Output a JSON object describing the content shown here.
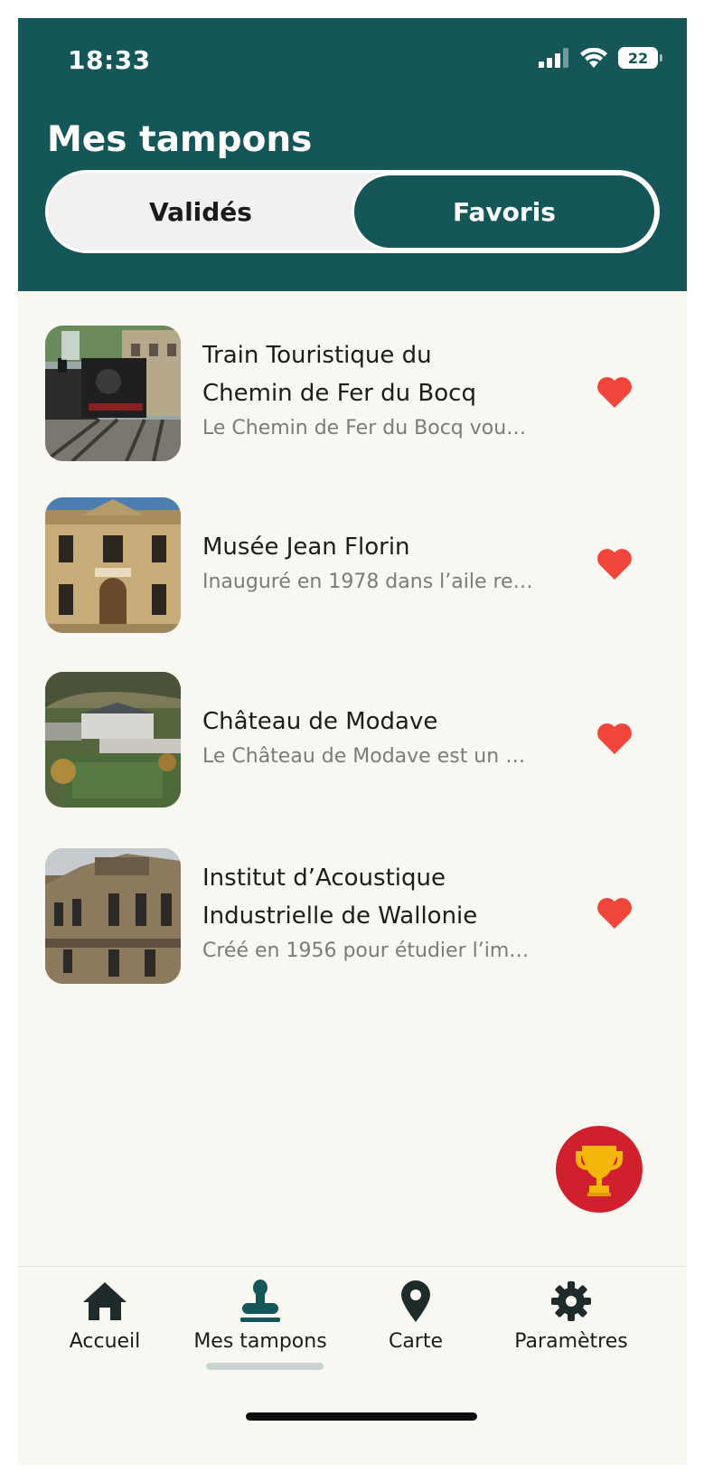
{
  "status_bar": {
    "time": "18:33",
    "battery": "22"
  },
  "header": {
    "title": "Mes tampons",
    "tabs": [
      {
        "label": "Validés",
        "active": false
      },
      {
        "label": "Favoris",
        "active": true
      }
    ]
  },
  "favorites": [
    {
      "title_line1": "Train Touristique du",
      "title_line2": "Chemin de Fer du Bocq",
      "description": "Le Chemin de Fer du Bocq vou…",
      "favorite": true
    },
    {
      "title_line1": "Musée Jean Florin",
      "title_line2": "",
      "description": "Inauguré en 1978 dans l’aile re…",
      "favorite": true
    },
    {
      "title_line1": "Château de Modave",
      "title_line2": "",
      "description": "Le Château de Modave est un …",
      "favorite": true
    },
    {
      "title_line1": "Institut d’Acoustique",
      "title_line2": "Industrielle de Wallonie",
      "description": "Créé en 1956 pour étudier l’im…",
      "favorite": true
    }
  ],
  "bottom_nav": [
    {
      "label": "Accueil",
      "icon": "home-icon",
      "active": false
    },
    {
      "label": "Mes tampons",
      "icon": "stamp-icon",
      "active": true
    },
    {
      "label": "Carte",
      "icon": "map-pin-icon",
      "active": false
    },
    {
      "label": "Paramètres",
      "icon": "gear-icon",
      "active": false
    }
  ],
  "colors": {
    "primary": "#155759",
    "background": "#f9f7f1",
    "heart": "#f0453a",
    "fab": "#d0202e",
    "trophy": "#f5b70a"
  }
}
